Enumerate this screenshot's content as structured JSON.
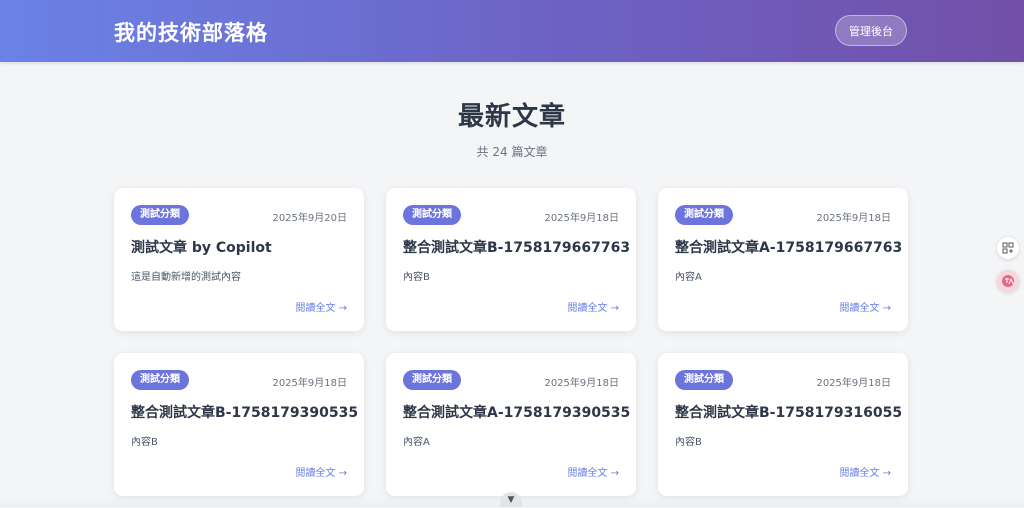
{
  "header": {
    "site_title": "我的技術部落格",
    "admin_label": "管理後台"
  },
  "main": {
    "title": "最新文章",
    "count_text": "共 24 篇文章"
  },
  "posts": [
    {
      "category": "測試分類",
      "date": "2025年9月20日",
      "title": "測試文章 by Copilot",
      "excerpt": "這是自動新增的測試內容",
      "read_more": "閱讀全文 →"
    },
    {
      "category": "測試分類",
      "date": "2025年9月18日",
      "title": "整合測試文章B-1758179667763",
      "excerpt": "內容B",
      "read_more": "閱讀全文 →"
    },
    {
      "category": "測試分類",
      "date": "2025年9月18日",
      "title": "整合測試文章A-1758179667763",
      "excerpt": "內容A",
      "read_more": "閱讀全文 →"
    },
    {
      "category": "測試分類",
      "date": "2025年9月18日",
      "title": "整合測試文章B-1758179390535",
      "excerpt": "內容B",
      "read_more": "閱讀全文 →"
    },
    {
      "category": "測試分類",
      "date": "2025年9月18日",
      "title": "整合測試文章A-1758179390535",
      "excerpt": "內容A",
      "read_more": "閱讀全文 →"
    },
    {
      "category": "測試分類",
      "date": "2025年9月18日",
      "title": "整合測試文章B-1758179316055",
      "excerpt": "內容B",
      "read_more": "閱讀全文 →"
    }
  ],
  "icons": {
    "side_top": "grid-plus-icon",
    "side_bottom": "translate-icon",
    "scroll": "chevron-down-icon"
  },
  "colors": {
    "accent": "#667eea",
    "badge": "#6d75dd",
    "header_start": "#6b82e6",
    "header_end": "#7250a8"
  }
}
